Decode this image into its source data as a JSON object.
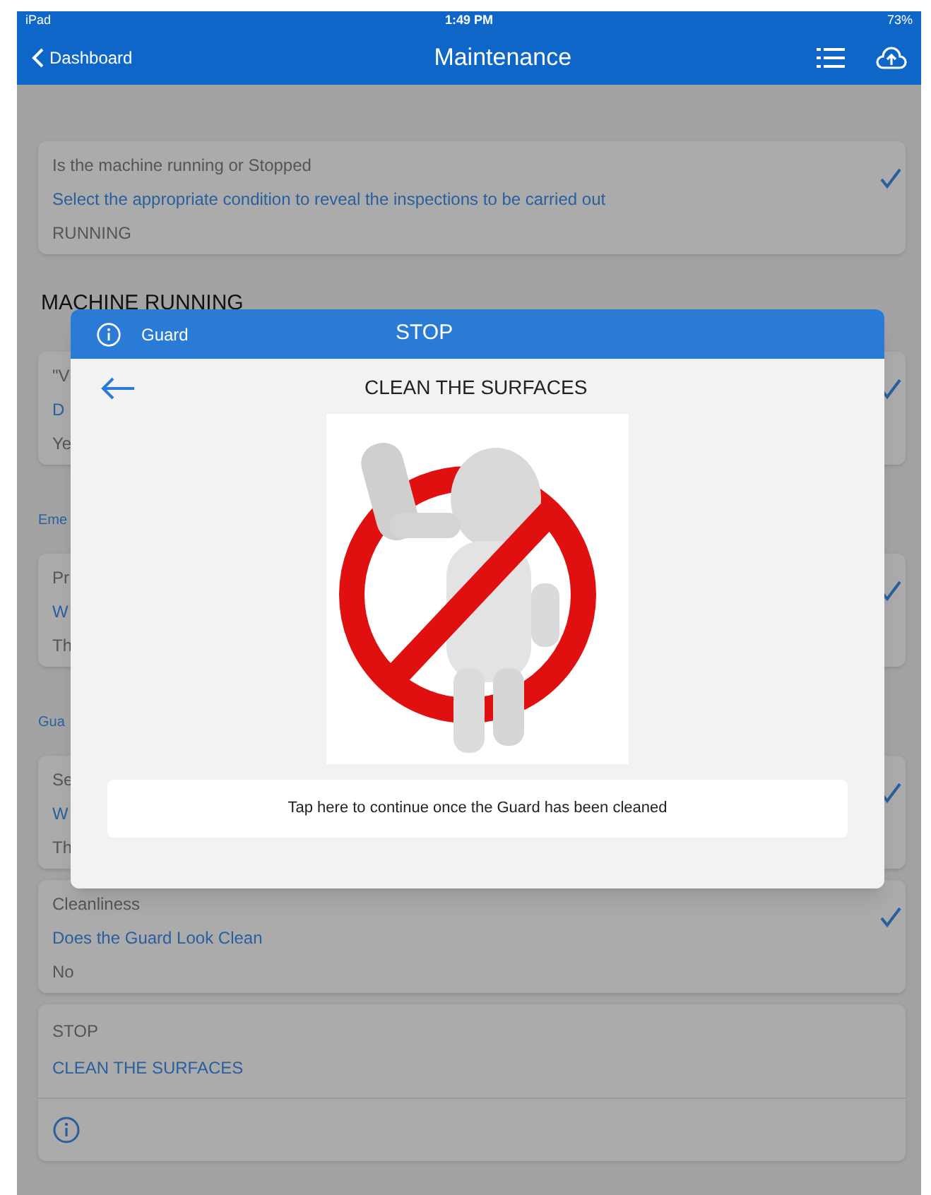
{
  "status_bar": {
    "device": "iPad",
    "time": "1:49 PM",
    "battery": "73%"
  },
  "nav": {
    "back": "Dashboard",
    "title": "Maintenance"
  },
  "content": [
    {
      "kind": "card",
      "label": "Is the machine running or Stopped",
      "question": "Select the appropriate condition to reveal the inspections to be carried out",
      "answer": "RUNNING",
      "checked": true
    },
    {
      "kind": "heading",
      "text": "MACHINE RUNNING"
    },
    {
      "kind": "card",
      "label": "\"V",
      "question": "D",
      "answer": "Ye",
      "checked": true
    },
    {
      "kind": "subheading",
      "text": "Eme"
    },
    {
      "kind": "card",
      "label": "Pr",
      "question": "W",
      "answer": "Th",
      "checked": true
    },
    {
      "kind": "subheading",
      "text": "Gua"
    },
    {
      "kind": "card",
      "label": "Se",
      "question": "W",
      "answer": "Th",
      "checked": true
    },
    {
      "kind": "card",
      "label": "Cleanliness",
      "question": "Does the Guard Look Clean",
      "answer": "No",
      "checked": true
    },
    {
      "kind": "info_card",
      "label": "STOP",
      "question": "CLEAN THE SURFACES"
    }
  ],
  "dialog": {
    "category": "Guard",
    "title": "STOP",
    "subtitle": "CLEAN THE SURFACES",
    "continue_button": "Tap here to continue once the Guard has been cleaned"
  }
}
